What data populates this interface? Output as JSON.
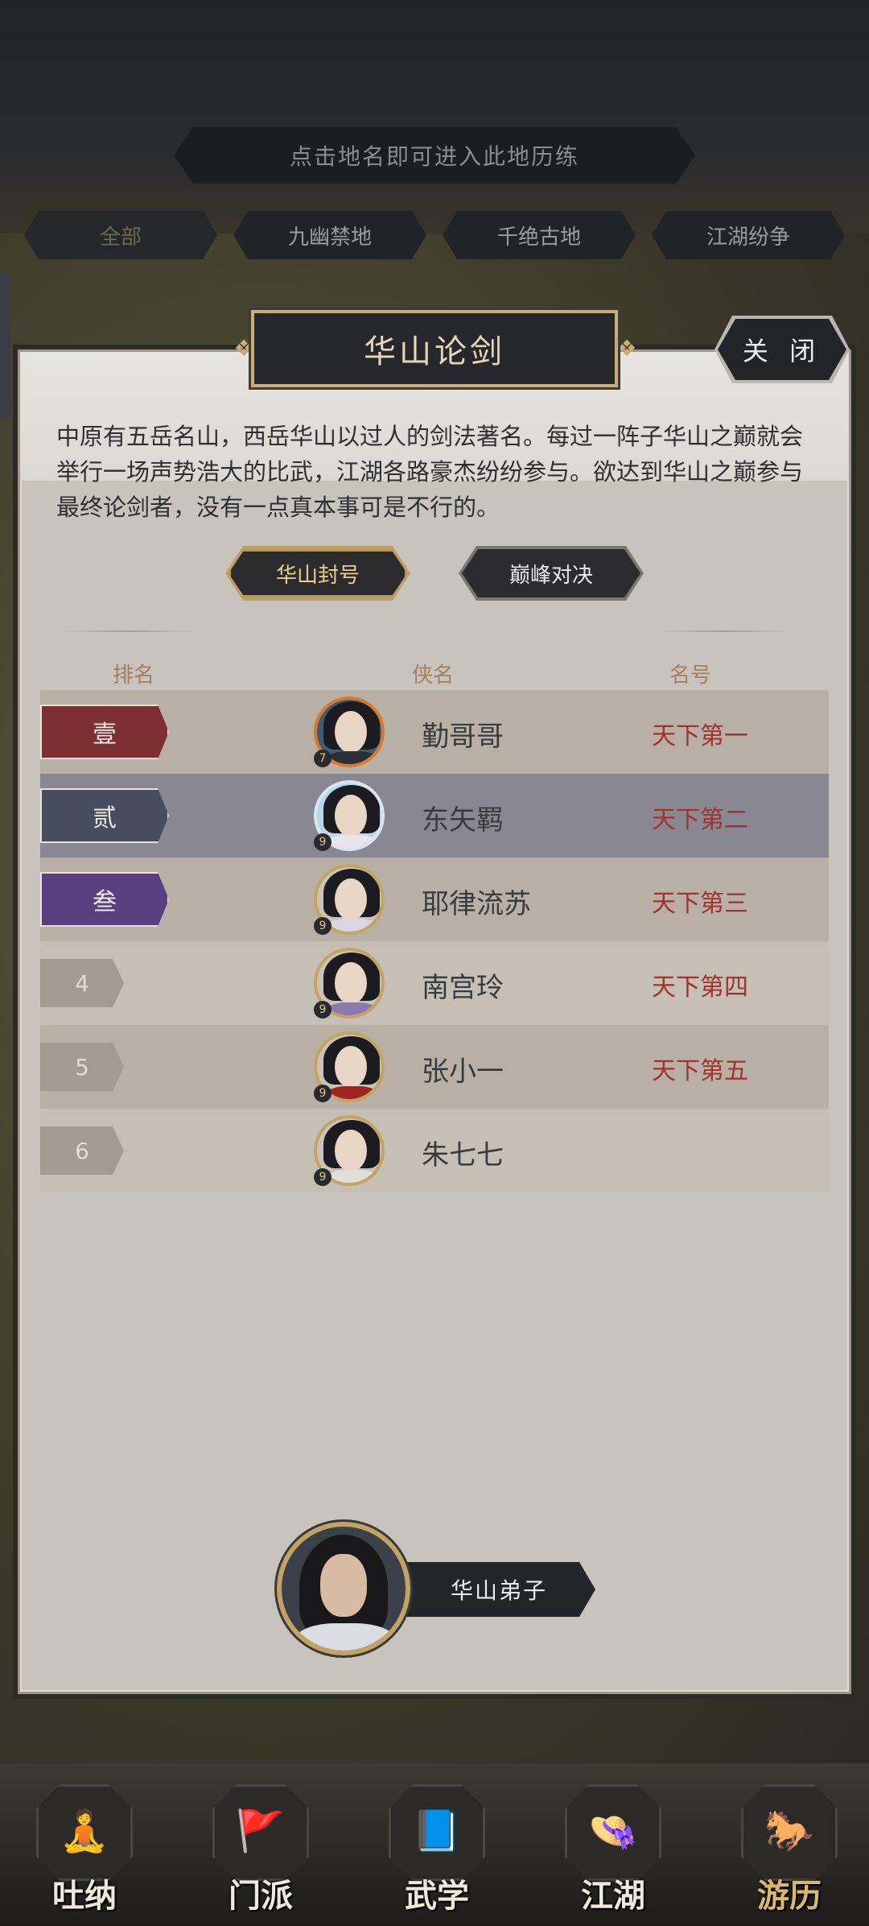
{
  "hint": "点击地名即可进入此地历练",
  "filters": [
    "全部",
    "九幽禁地",
    "千绝古地",
    "江湖纷争"
  ],
  "panel": {
    "title": "华山论剑",
    "close_label": "关 闭",
    "description": "中原有五岳名山，西岳华山以过人的剑法著名。每过一阵子华山之巅就会举行一场声势浩大的比武，江湖各路豪杰纷纷参与。欲达到华山之巅参与最终论剑者，没有一点真本事可是不行的。",
    "subtabs": [
      "华山封号",
      "巅峰对决"
    ],
    "columns": {
      "rank": "排名",
      "name": "侠名",
      "title": "名号"
    }
  },
  "rankings": [
    {
      "rank": "壹",
      "name": "勤哥哥",
      "title": "天下第一",
      "badge_color": "#7d2f31",
      "level": "7"
    },
    {
      "rank": "贰",
      "name": "东矢羁",
      "title": "天下第二",
      "badge_color": "#454d5e",
      "level": "9"
    },
    {
      "rank": "叁",
      "name": "耶律流苏",
      "title": "天下第三",
      "badge_color": "#5a3f80",
      "level": "9"
    },
    {
      "rank": "4",
      "name": "南宫玲",
      "title": "天下第四",
      "level": "9"
    },
    {
      "rank": "5",
      "name": "张小一",
      "title": "天下第五",
      "level": "9"
    },
    {
      "rank": "6",
      "name": "朱七七",
      "title": "",
      "level": "9"
    }
  ],
  "player": {
    "title": "华山弟子"
  },
  "nav": [
    {
      "label": "吐纳",
      "icon": "meditation-figure-icon",
      "glyph": "🧘",
      "active": false
    },
    {
      "label": "门派",
      "icon": "sect-banner-icon",
      "glyph": "🚩",
      "active": false
    },
    {
      "label": "武学",
      "icon": "martial-books-icon",
      "glyph": "📘",
      "active": false
    },
    {
      "label": "江湖",
      "icon": "straw-hat-icon",
      "glyph": "👒",
      "active": false
    },
    {
      "label": "游历",
      "icon": "horse-icon",
      "glyph": "🐎",
      "active": true
    }
  ],
  "colors": {
    "title_red": "#a3312d",
    "accent_gold": "#c9ad74"
  }
}
